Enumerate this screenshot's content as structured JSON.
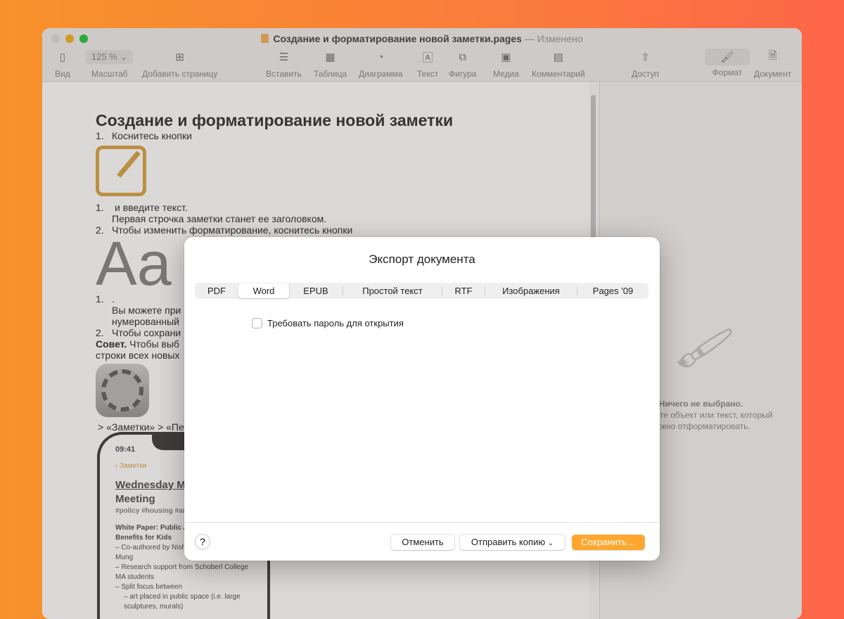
{
  "window": {
    "title": "Создание и форматирование новой заметки.pages",
    "status": "— Изменено"
  },
  "toolbar": {
    "view": "Вид",
    "zoom_value": "125 %",
    "zoom": "Масштаб",
    "add_page": "Добавить страницу",
    "insert": "Вставить",
    "table": "Таблица",
    "chart": "Диаграмма",
    "text": "Текст",
    "shape": "Фигура",
    "media": "Медиа",
    "comment": "Комментарий",
    "share": "Доступ",
    "format": "Формат",
    "document": "Документ"
  },
  "document": {
    "heading": "Создание и форматирование новой заметки",
    "lines": [
      "Коснитесь кнопки",
      "и введите текст.",
      "Первая строчка заметки станет ее заголовком.",
      "Чтобы изменить форматирование, коснитесь кнопки",
      ".",
      "Вы можете при",
      "нумерованный",
      "Чтобы сохрани"
    ],
    "nums": [
      "1.",
      "1.",
      "2.",
      "1.",
      "2."
    ],
    "tip_bold": "Совет.",
    "tip": " Чтобы выб",
    "tip2": "строки всех новых",
    "breadcrumb": "> «Заметки» > «Пе",
    "phone": {
      "time": "09:41",
      "back": "Заметки",
      "title": "Wednesday M",
      "title2": "Meeting",
      "tags": "#policy #housing #art",
      "p1": "White Paper: Public A",
      "p2": "Benefits for Kids",
      "l1": "– Co-authored by Nish",
      "l2": "Mung",
      "l3": "– Research support from Schoberl College",
      "l4": "MA students",
      "l5": "– Split focus between",
      "l6": "– art placed in public space (i.e. large",
      "l7": "sculptures, murals)"
    }
  },
  "sidebar": {
    "empty_title": "Ничего не выбрано.",
    "empty_text1": "Выберите объект или текст, который",
    "empty_text2": "нужно отформатировать."
  },
  "dialog": {
    "title": "Экспорт документа",
    "tabs": [
      "PDF",
      "Word",
      "EPUB",
      "Простой текст",
      "RTF",
      "Изображения",
      "Pages '09"
    ],
    "selected_tab": "Word",
    "password_label": "Требовать пароль для открытия",
    "password_checked": false,
    "help": "?",
    "cancel": "Отменить",
    "send_copy": "Отправить копию",
    "save": "Сохранить…"
  },
  "colors": {
    "accent": "#fea730",
    "close": "#e0dedd",
    "minimize": "#f5b22a",
    "zoom": "#2ac840"
  }
}
